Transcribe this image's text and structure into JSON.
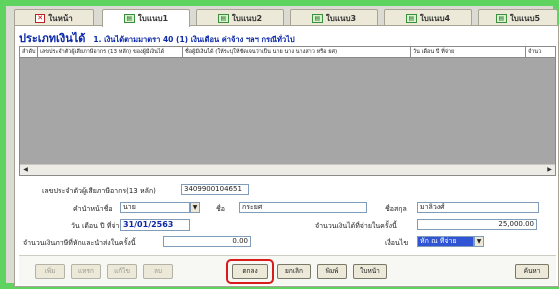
{
  "tabs": [
    {
      "label": "ในหน้า",
      "icon": "close-tab-icon"
    },
    {
      "label": "ใบแนบ1",
      "icon": "document-icon"
    },
    {
      "label": "ใบแนบ2",
      "icon": "document-icon"
    },
    {
      "label": "ใบแนบ3",
      "icon": "document-icon"
    },
    {
      "label": "ใบแนบ4",
      "icon": "document-icon"
    },
    {
      "label": "ใบแนบ5",
      "icon": "document-icon"
    }
  ],
  "heading": {
    "title": "ประเภทเงินได้",
    "subtitle": "1. เงินได้ตามมาตรา 40 (1) เงินเดือน ค่าจ้าง ฯลฯ กรณีทั่วไป"
  },
  "grid": {
    "columns": [
      "ลำดับ",
      "เลขประจำตัวผู้เสียภาษีอากร (13 หลัก) ของผู้มีเงินได้",
      "ชื่อผู้มีเงินได้ (ให้ระบุให้ชัดเจนว่าเป็น นาย นาง นางสาว หรือ ยศ)",
      "วัน เดือน ปี ที่จ่าย",
      "จำนว"
    ]
  },
  "form": {
    "tax_id_label": "เลขประจำตัวผู้เสียภาษีอากร(13 หลัก)",
    "tax_id_value": "3409900104651",
    "prefix_label": "คำนำหน้าชื่อ",
    "prefix_value": "นาย",
    "first_name_label": "ชื่อ",
    "first_name_value": "กระยศ",
    "last_name_label": "ชื่อสกุล",
    "last_name_value": "มาลิวงศ์",
    "pay_date_label": "วัน เดือน ปี ที่จ่าย",
    "pay_date_value": "31/01/2563",
    "income_label": "จำนวนเงินได้ที่จ่ายในครั้งนี้",
    "income_value": "25,000.00",
    "withheld_label": "จำนวนเงินภาษีที่หักและนำส่งในครั้งนี้",
    "withheld_value": "0.00",
    "condition_label": "เงื่อนไข",
    "condition_value": "หัก ณ ที่จ่าย"
  },
  "buttons": {
    "add": "เพิ่ม",
    "insert": "แทรก",
    "edit": "แก้ไข",
    "delete": "ลบ",
    "ok": "ตกลง",
    "cancel": "ยกเลิก",
    "print": "พิมพ์",
    "main_page": "ใบหน้า",
    "search": "ค้นหา"
  },
  "colors": {
    "frame_border": "#5fd35f",
    "heading": "#0b28a8",
    "highlight": "#d81b1b"
  }
}
